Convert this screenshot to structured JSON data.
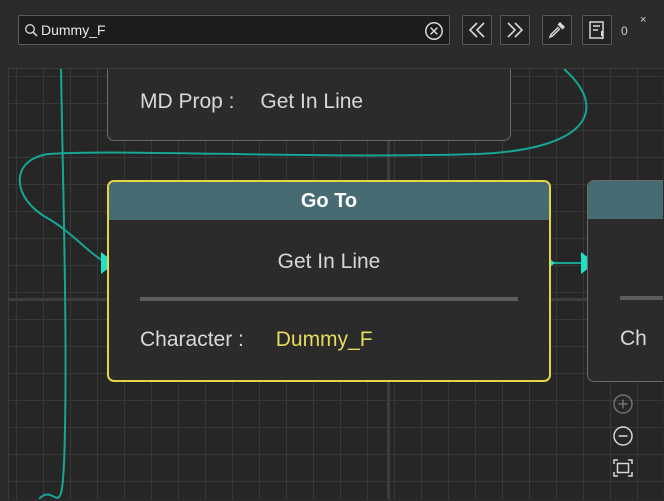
{
  "search": {
    "value": "Dummy_F",
    "placeholder": ""
  },
  "toolbar": {
    "match_count": "0",
    "close_glyph": "×"
  },
  "icons": {
    "search": "magnifier-icon",
    "clear": "circle-x-icon",
    "prev": "double-chevron-left-icon",
    "next": "double-chevron-right-icon",
    "picker": "eyedropper-icon",
    "filter": "filter-list-icon"
  },
  "nodes": {
    "top": {
      "label": "MD Prop :",
      "value": "Get In Line"
    },
    "main": {
      "title": "Go To",
      "subtitle": "Get In Line",
      "param_label": "Character :",
      "param_value": "Dummy_F"
    },
    "right": {
      "param_label_partial": "Ch"
    }
  },
  "colors": {
    "wire": "#18a594",
    "pin": "#1de2c8",
    "selection": "#e8d545",
    "header": "#466b73",
    "value_highlight": "#e8da5a"
  }
}
